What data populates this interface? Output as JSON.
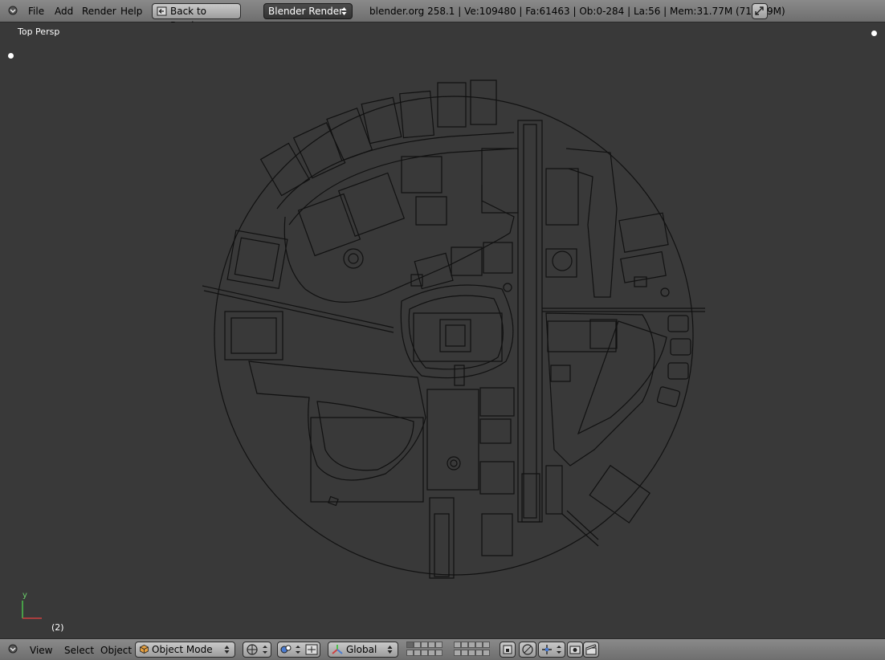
{
  "header": {
    "menus": [
      "File",
      "Add",
      "Render",
      "Help"
    ],
    "back_button": "Back to Previous",
    "render_engine": "Blender Render",
    "stats": "blender.org 258.1 | Ve:109480 | Fa:61463 | Ob:0-284 | La:56 | Mem:31.77M (718.49M)"
  },
  "viewport": {
    "view_label": "Top Persp",
    "axis_label": "y",
    "frame_label": "(2)"
  },
  "footer": {
    "menus": [
      "View",
      "Select",
      "Object"
    ],
    "mode": "Object Mode",
    "orientation": "Global"
  },
  "colors": {
    "header_bg": "#7d7d7d",
    "viewport_bg": "#393939",
    "wire": "#111111",
    "axis_x": "#d04040",
    "axis_y": "#4cc04c"
  }
}
